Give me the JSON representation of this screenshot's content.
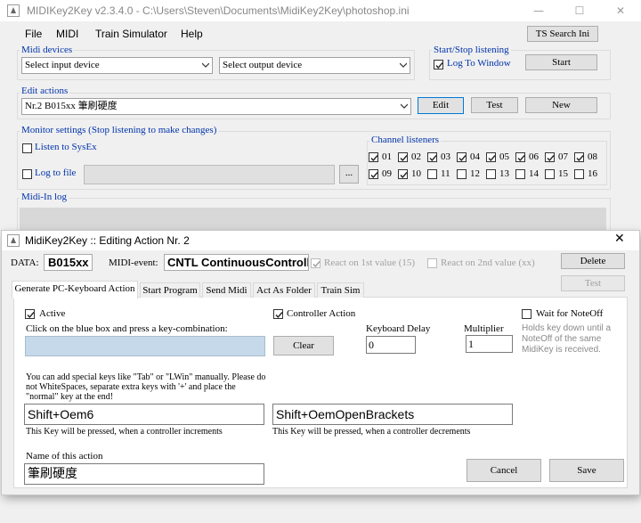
{
  "main": {
    "title": "MIDIKey2Key v2.3.4.0 - C:\\Users\\Steven\\Documents\\MidiKey2Key\\photoshop.ini",
    "menu": [
      "File",
      "MIDI",
      "Train Simulator",
      "Help"
    ],
    "midi_devices": {
      "label": "Midi devices",
      "input": "Select input device",
      "output": "Select output device"
    },
    "start_stop": {
      "label": "Start/Stop listening",
      "log_to_window": "Log To Window",
      "log_to_window_checked": true,
      "start": "Start"
    },
    "ts_search_ini": "TS Search Ini",
    "edit_actions": {
      "label": "Edit actions",
      "selected": "Nr.2 B015xx 筆刷硬度",
      "edit": "Edit",
      "test": "Test",
      "new": "New"
    },
    "monitor": {
      "label": "Monitor settings (Stop listening to make changes)",
      "listen_sysex": "Listen to SysEx",
      "listen_sysex_checked": false,
      "log_to_file": "Log to file",
      "log_to_file_checked": false,
      "log_path": "",
      "browse": "..."
    },
    "channels": {
      "label": "Channel listeners",
      "items": [
        {
          "n": "01",
          "checked": true
        },
        {
          "n": "02",
          "checked": true
        },
        {
          "n": "03",
          "checked": true
        },
        {
          "n": "04",
          "checked": true
        },
        {
          "n": "05",
          "checked": true
        },
        {
          "n": "06",
          "checked": true
        },
        {
          "n": "07",
          "checked": true
        },
        {
          "n": "08",
          "checked": true
        },
        {
          "n": "09",
          "checked": true
        },
        {
          "n": "10",
          "checked": true
        },
        {
          "n": "11",
          "checked": false
        },
        {
          "n": "12",
          "checked": false
        },
        {
          "n": "13",
          "checked": false
        },
        {
          "n": "14",
          "checked": false
        },
        {
          "n": "15",
          "checked": false
        },
        {
          "n": "16",
          "checked": false
        }
      ]
    },
    "midi_in_log": "Midi-In log"
  },
  "dialog": {
    "title": "MidiKey2Key :: Editing Action Nr. 2",
    "data_label": "DATA:",
    "data_value": "B015xx",
    "midi_event_label": "MIDI-event:",
    "midi_event_value": "CNTL ContinuousControll",
    "react_1st": "React on 1st value (15)",
    "react_1st_checked": true,
    "react_2nd": "React on 2nd value (xx)",
    "react_2nd_checked": false,
    "delete": "Delete",
    "test": "Test",
    "tabs": [
      "Generate PC-Keyboard Action",
      "Start Program",
      "Send Midi",
      "Act As Folder",
      "Train Sim"
    ],
    "active": "Active",
    "active_checked": true,
    "controller_action": "Controller Action",
    "controller_action_checked": true,
    "wait_noteoff": "Wait for NoteOff",
    "wait_noteoff_checked": false,
    "wait_hint": "Holds key down until a NoteOff of the same MidiKey is received.",
    "key_combo_hint": "Click on the blue box and press a key-combination:",
    "clear": "Clear",
    "keyboard_delay_label": "Keyboard Delay",
    "keyboard_delay": "0",
    "multiplier_label": "Multiplier",
    "multiplier": "1",
    "special_keys_hint": "You can add special keys like \"Tab\" or \"LWin\" manually. Please do not WhiteSpaces, separate extra keys with '+' and place the \"normal\" key at the end!",
    "key_increment": "Shift+Oem6",
    "key_increment_hint": "This Key will be pressed, when a controller increments",
    "key_decrement": "Shift+OemOpenBrackets",
    "key_decrement_hint": "This Key will be pressed, when a controller decrements",
    "name_label": "Name of this action",
    "name_value": "筆刷硬度",
    "cancel": "Cancel",
    "save": "Save"
  },
  "colors": {
    "accent": "#0078d7",
    "group_label": "#0033aa",
    "key_box": "#c5d9ea"
  }
}
